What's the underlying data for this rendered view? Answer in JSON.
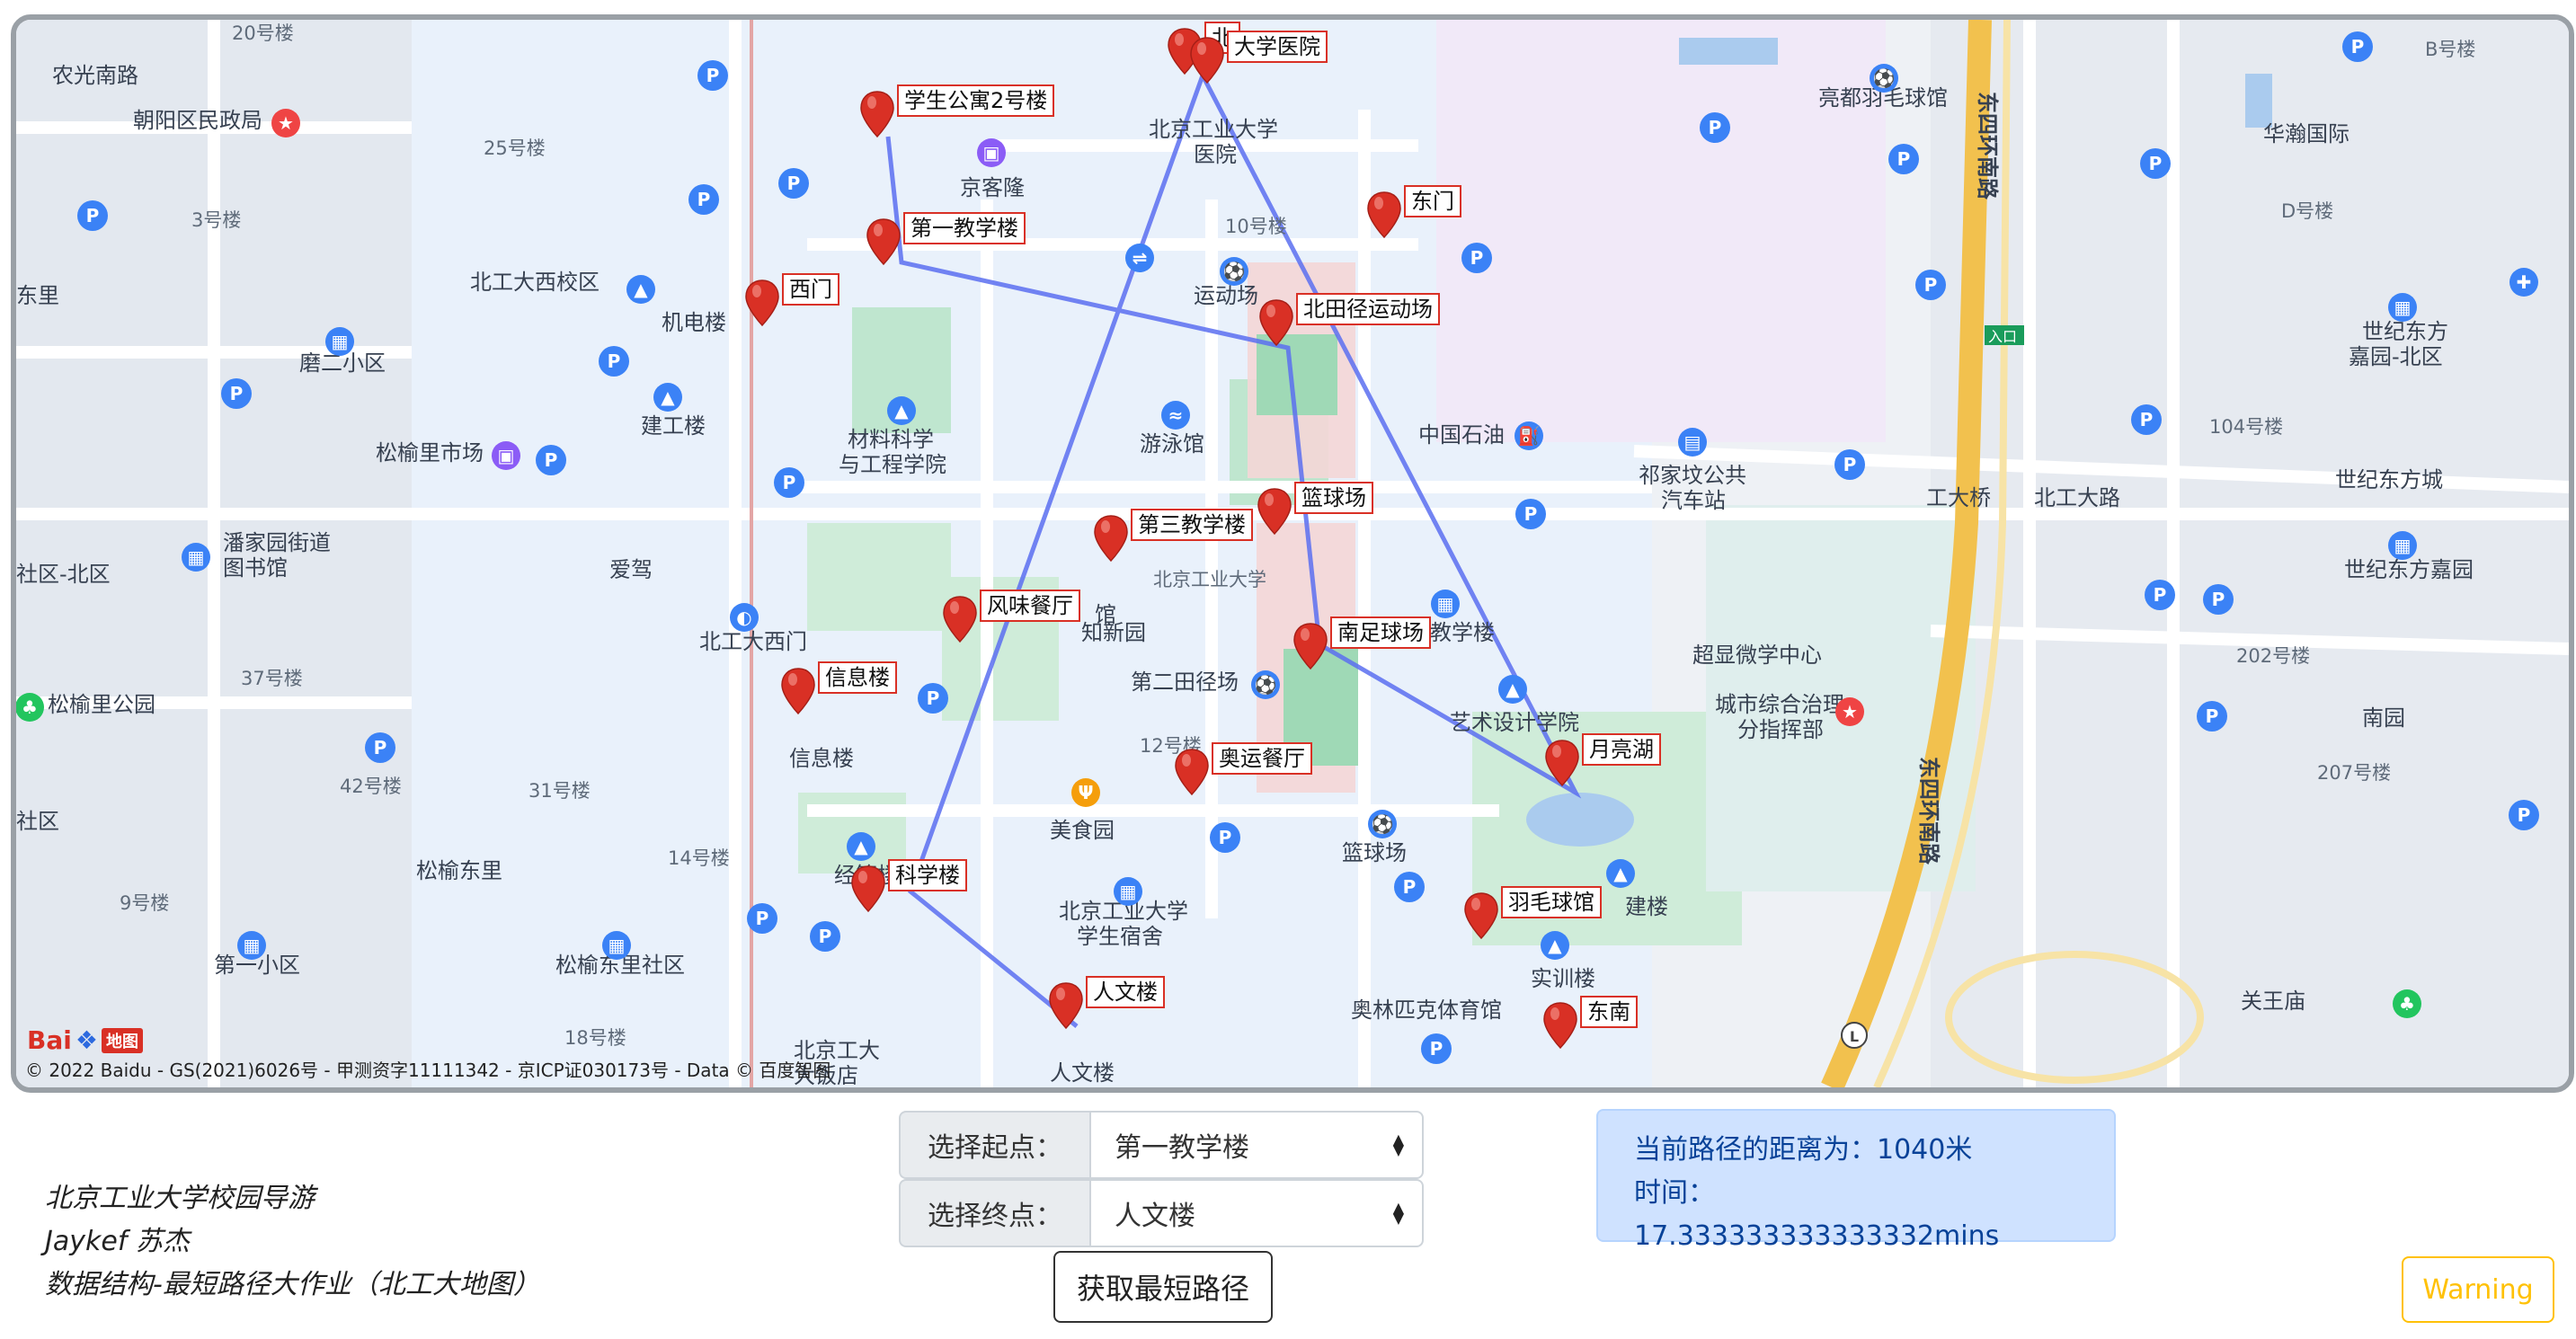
{
  "map": {
    "copyright": "© 2022 Baidu - GS(2021)6026号 - 甲测资字11111342 - 京ICP证030173号 - Data © 百度智图",
    "logo_text": "Bai",
    "logo_tag": "地图",
    "markers": [
      {
        "label": "北"
      },
      {
        "label": "大学医院"
      },
      {
        "label": "学生公寓2号楼"
      },
      {
        "label": "第一教学楼"
      },
      {
        "label": "西门"
      },
      {
        "label": "东门"
      },
      {
        "label": "北田径运动场"
      },
      {
        "label": "篮球场"
      },
      {
        "label": "第三教学楼"
      },
      {
        "label": "风味餐厅"
      },
      {
        "label": "南足球场"
      },
      {
        "label": "信息楼"
      },
      {
        "label": "月亮湖"
      },
      {
        "label": "奥运餐厅"
      },
      {
        "label": "科学楼"
      },
      {
        "label": "羽毛球馆"
      },
      {
        "label": "人文楼"
      },
      {
        "label": "东南"
      }
    ],
    "places": {
      "l1": "20号楼",
      "l2": "农光南路",
      "l3": "朝阳区民政局",
      "l4": "25号楼",
      "l5": "3号楼",
      "l6": "北工大西校区",
      "l7": "机电楼",
      "l8": "磨二小区",
      "l9": "建工楼",
      "l10": "松榆里市场",
      "l11": "潘家园街道",
      "l12": "图书馆",
      "l13": "爱驾",
      "l14": "北工大西门",
      "l15": "37号楼",
      "l16": "松榆里公园",
      "l17": "42号楼",
      "l18": "31号楼",
      "l19": "14号楼",
      "l20": "松榆东里",
      "l21": "9号楼",
      "l22": "第一小区",
      "l23": "松榆东里社区",
      "l24": "18号楼",
      "l25": "信息楼",
      "l26": "经管楼",
      "l27": "北京工大",
      "l28": "大饭店",
      "l29": "京客隆",
      "l30": "北京工业大学",
      "l31": "医院",
      "l32": "10号楼",
      "l33": "运动场",
      "l34": "材料科学",
      "l35": "与工程学院",
      "l36": "游泳馆",
      "l37": "中国石油",
      "l38": "知新园",
      "l39": "北京工业大学",
      "l40": "第二田径场",
      "l41": "12号楼",
      "l42": "美食园",
      "l43": "北京工业大学",
      "l44": "学生宿舍",
      "l45": "篮球场",
      "l46": "第四教学楼",
      "l47": "艺术设计学院",
      "l48": "超显微学中心",
      "l49": "城市综合治理",
      "l50": "分指挥部",
      "l51": "奥林匹克体育馆",
      "l52": "实训楼",
      "l53": "人文楼",
      "l54": "亮都羽毛球馆",
      "l55": "东四",
      "l56": "环",
      "l57": "南路",
      "l58": "B号楼",
      "l59": "华瀚国际",
      "l60": "D号楼",
      "l61": "世纪东方",
      "l62": "嘉园-北区",
      "l63": "104号楼",
      "l64": "世纪东方城",
      "l65": "工大桥",
      "l66": "北工大路",
      "l67": "祁家坟公共",
      "l68": "汽车站",
      "l69": "世纪东方嘉园",
      "l70": "202号楼",
      "l71": "南园",
      "l72": "207号楼",
      "l73": "关王庙",
      "l74": "东里",
      "l75": "社区-北区",
      "l76": "社区",
      "l77": "入口",
      "l78": "东四环南路",
      "l79": "建楼",
      "l80": "馆"
    }
  },
  "credits": {
    "line1": "北京工业大学校园导游",
    "line2": "Jaykef 苏杰",
    "line3": "数据结构-最短路径大作业（北工大地图）"
  },
  "form": {
    "start_label": "选择起点：",
    "start_value": "第一教学楼",
    "end_label": "选择终点：",
    "end_value": "人文楼",
    "button": "获取最短路径"
  },
  "result": {
    "distance": "当前路径的距离为：1040米",
    "time": "时间：17.333333333333332mins"
  },
  "warning": "Warning",
  "colors": {
    "route": "#5b6ff0",
    "pin": "#d93025",
    "alert_bg": "#cfe2ff",
    "warning": "#ffc107"
  }
}
